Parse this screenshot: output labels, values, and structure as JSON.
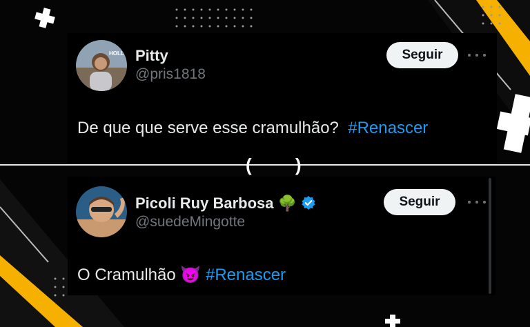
{
  "tweets": [
    {
      "name": "Pitty",
      "handle": "@pris1818",
      "follow_label": "Seguir",
      "text_before": "De que que serve esse cramulhão?",
      "hashtag": "#Renascer",
      "verified": false
    },
    {
      "name": "Picoli Ruy Barbosa",
      "name_emoji": "🌳",
      "handle": "@suedeMingotte",
      "follow_label": "Seguir",
      "text_before": "O Cramulhão",
      "text_emoji": "😈",
      "hashtag": "#Renascer",
      "verified": true
    }
  ],
  "separator": "(  )",
  "colors": {
    "accent": "#1d9bf0",
    "background": "#000000",
    "highlight": "#f5b000",
    "button": "#eff3f4",
    "muted": "#71767b"
  },
  "icons": [
    "more-icon",
    "verified-badge-icon",
    "plus-deco-icon"
  ]
}
